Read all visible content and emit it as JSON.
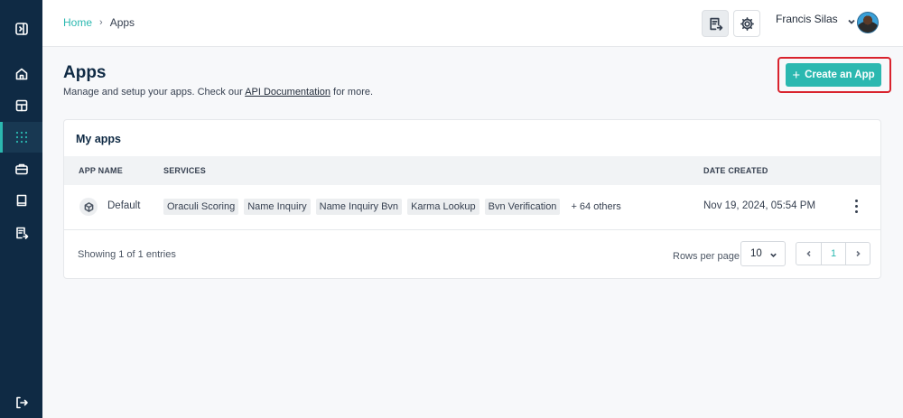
{
  "breadcrumb": {
    "home": "Home",
    "current": "Apps"
  },
  "user": {
    "name": "Francis Silas"
  },
  "page": {
    "title": "Apps",
    "subtitle_before": "Manage and setup your apps. Check our ",
    "subtitle_link": "API Documentation",
    "subtitle_after": " for more.",
    "create_button": "Create an App"
  },
  "card": {
    "title": "My apps",
    "columns": {
      "app_name": "APP NAME",
      "services": "SERVICES",
      "date_created": "DATE CREATED"
    },
    "rows": [
      {
        "app_name": "Default",
        "services": [
          "Oraculi Scoring",
          "Name Inquiry",
          "Name Inquiry Bvn",
          "Karma Lookup",
          "Bvn Verification"
        ],
        "others": "+ 64 others",
        "date_created": "Nov 19, 2024, 05:54 PM"
      }
    ],
    "footer": {
      "showing": "Showing 1 of 1 entries",
      "rows_per_page_label": "Rows per page",
      "rows_per_page_value": "10",
      "current_page": "1"
    }
  },
  "sidebar_icons": [
    "panel-toggle-icon",
    "home-icon",
    "layout-icon",
    "grid-dots-icon",
    "briefcase-icon",
    "book-icon",
    "document-export-icon",
    "logout-icon"
  ],
  "colors": {
    "sidebar": "#0f2a44",
    "accent": "#2bb8b0",
    "highlight": "#d9232d"
  }
}
